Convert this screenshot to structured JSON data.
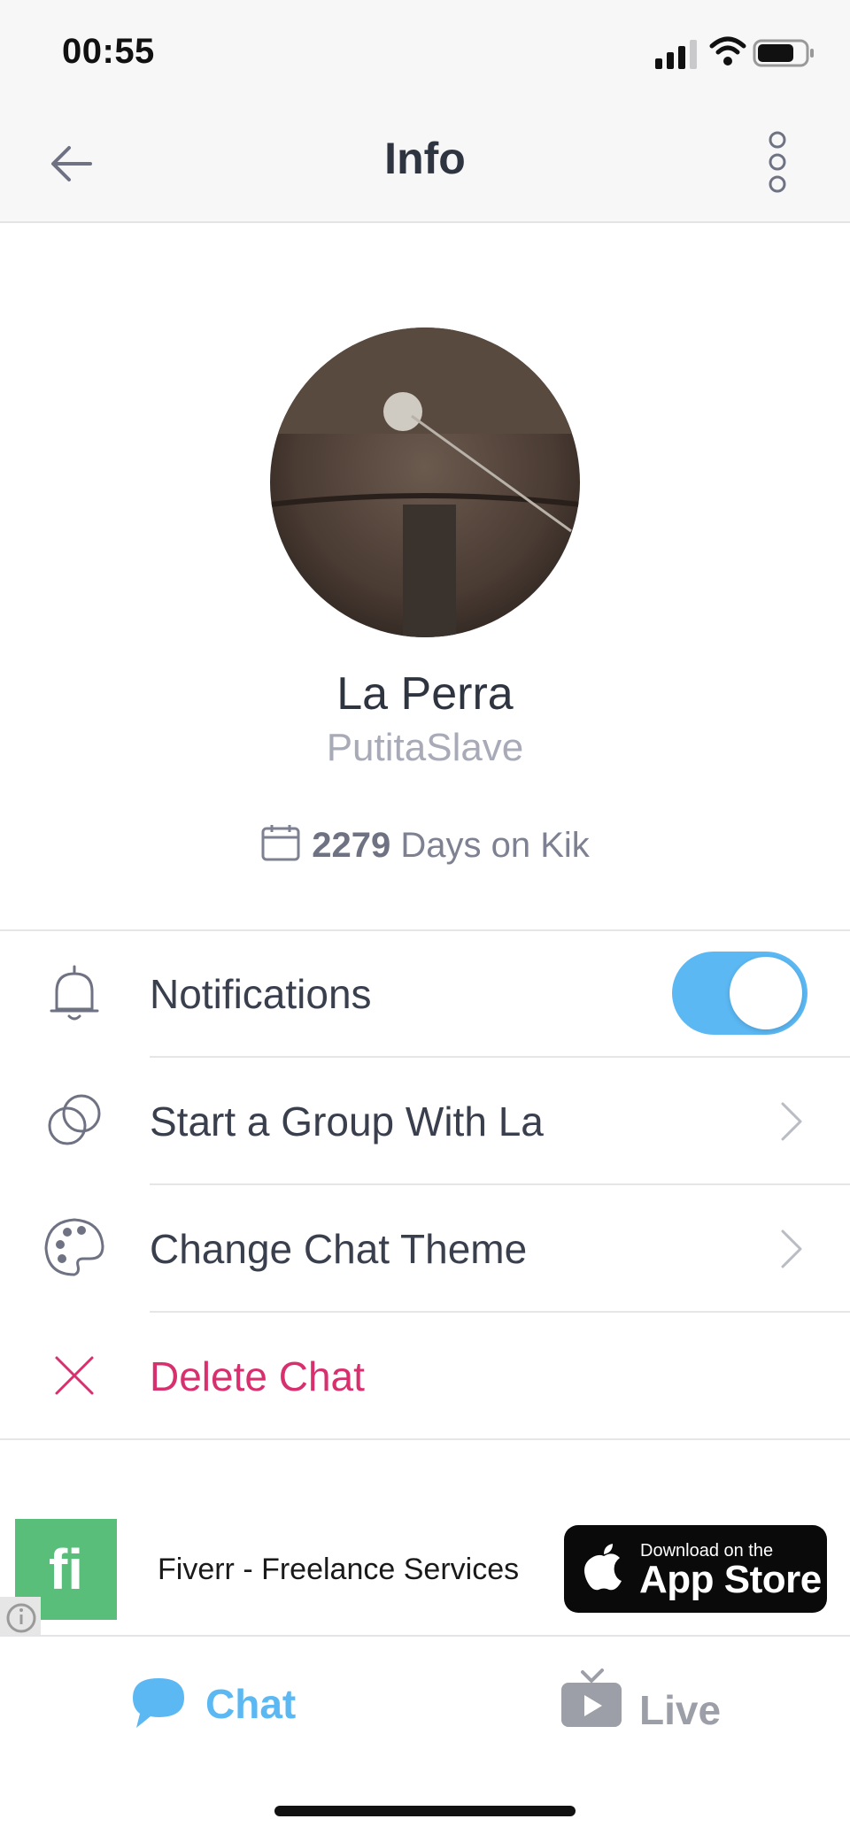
{
  "status_bar": {
    "time": "00:55"
  },
  "nav": {
    "title": "Info"
  },
  "profile": {
    "display_name": "La Perra",
    "username": "PutitaSlave",
    "days_count": "2279",
    "days_label": "Days on Kik"
  },
  "settings": {
    "notifications_label": "Notifications",
    "notifications_on": true,
    "start_group_label": "Start a Group With La",
    "change_theme_label": "Change Chat Theme",
    "delete_chat_label": "Delete Chat"
  },
  "ad": {
    "logo_text": "fi",
    "text": "Fiverr - Freelance Services",
    "store_small": "Download on the",
    "store_big": "App Store"
  },
  "tabs": {
    "chat_label": "Chat",
    "live_label": "Live"
  },
  "colors": {
    "accent": "#5bb8f3",
    "danger": "#d8306f",
    "ad_green": "#5abe7b"
  }
}
